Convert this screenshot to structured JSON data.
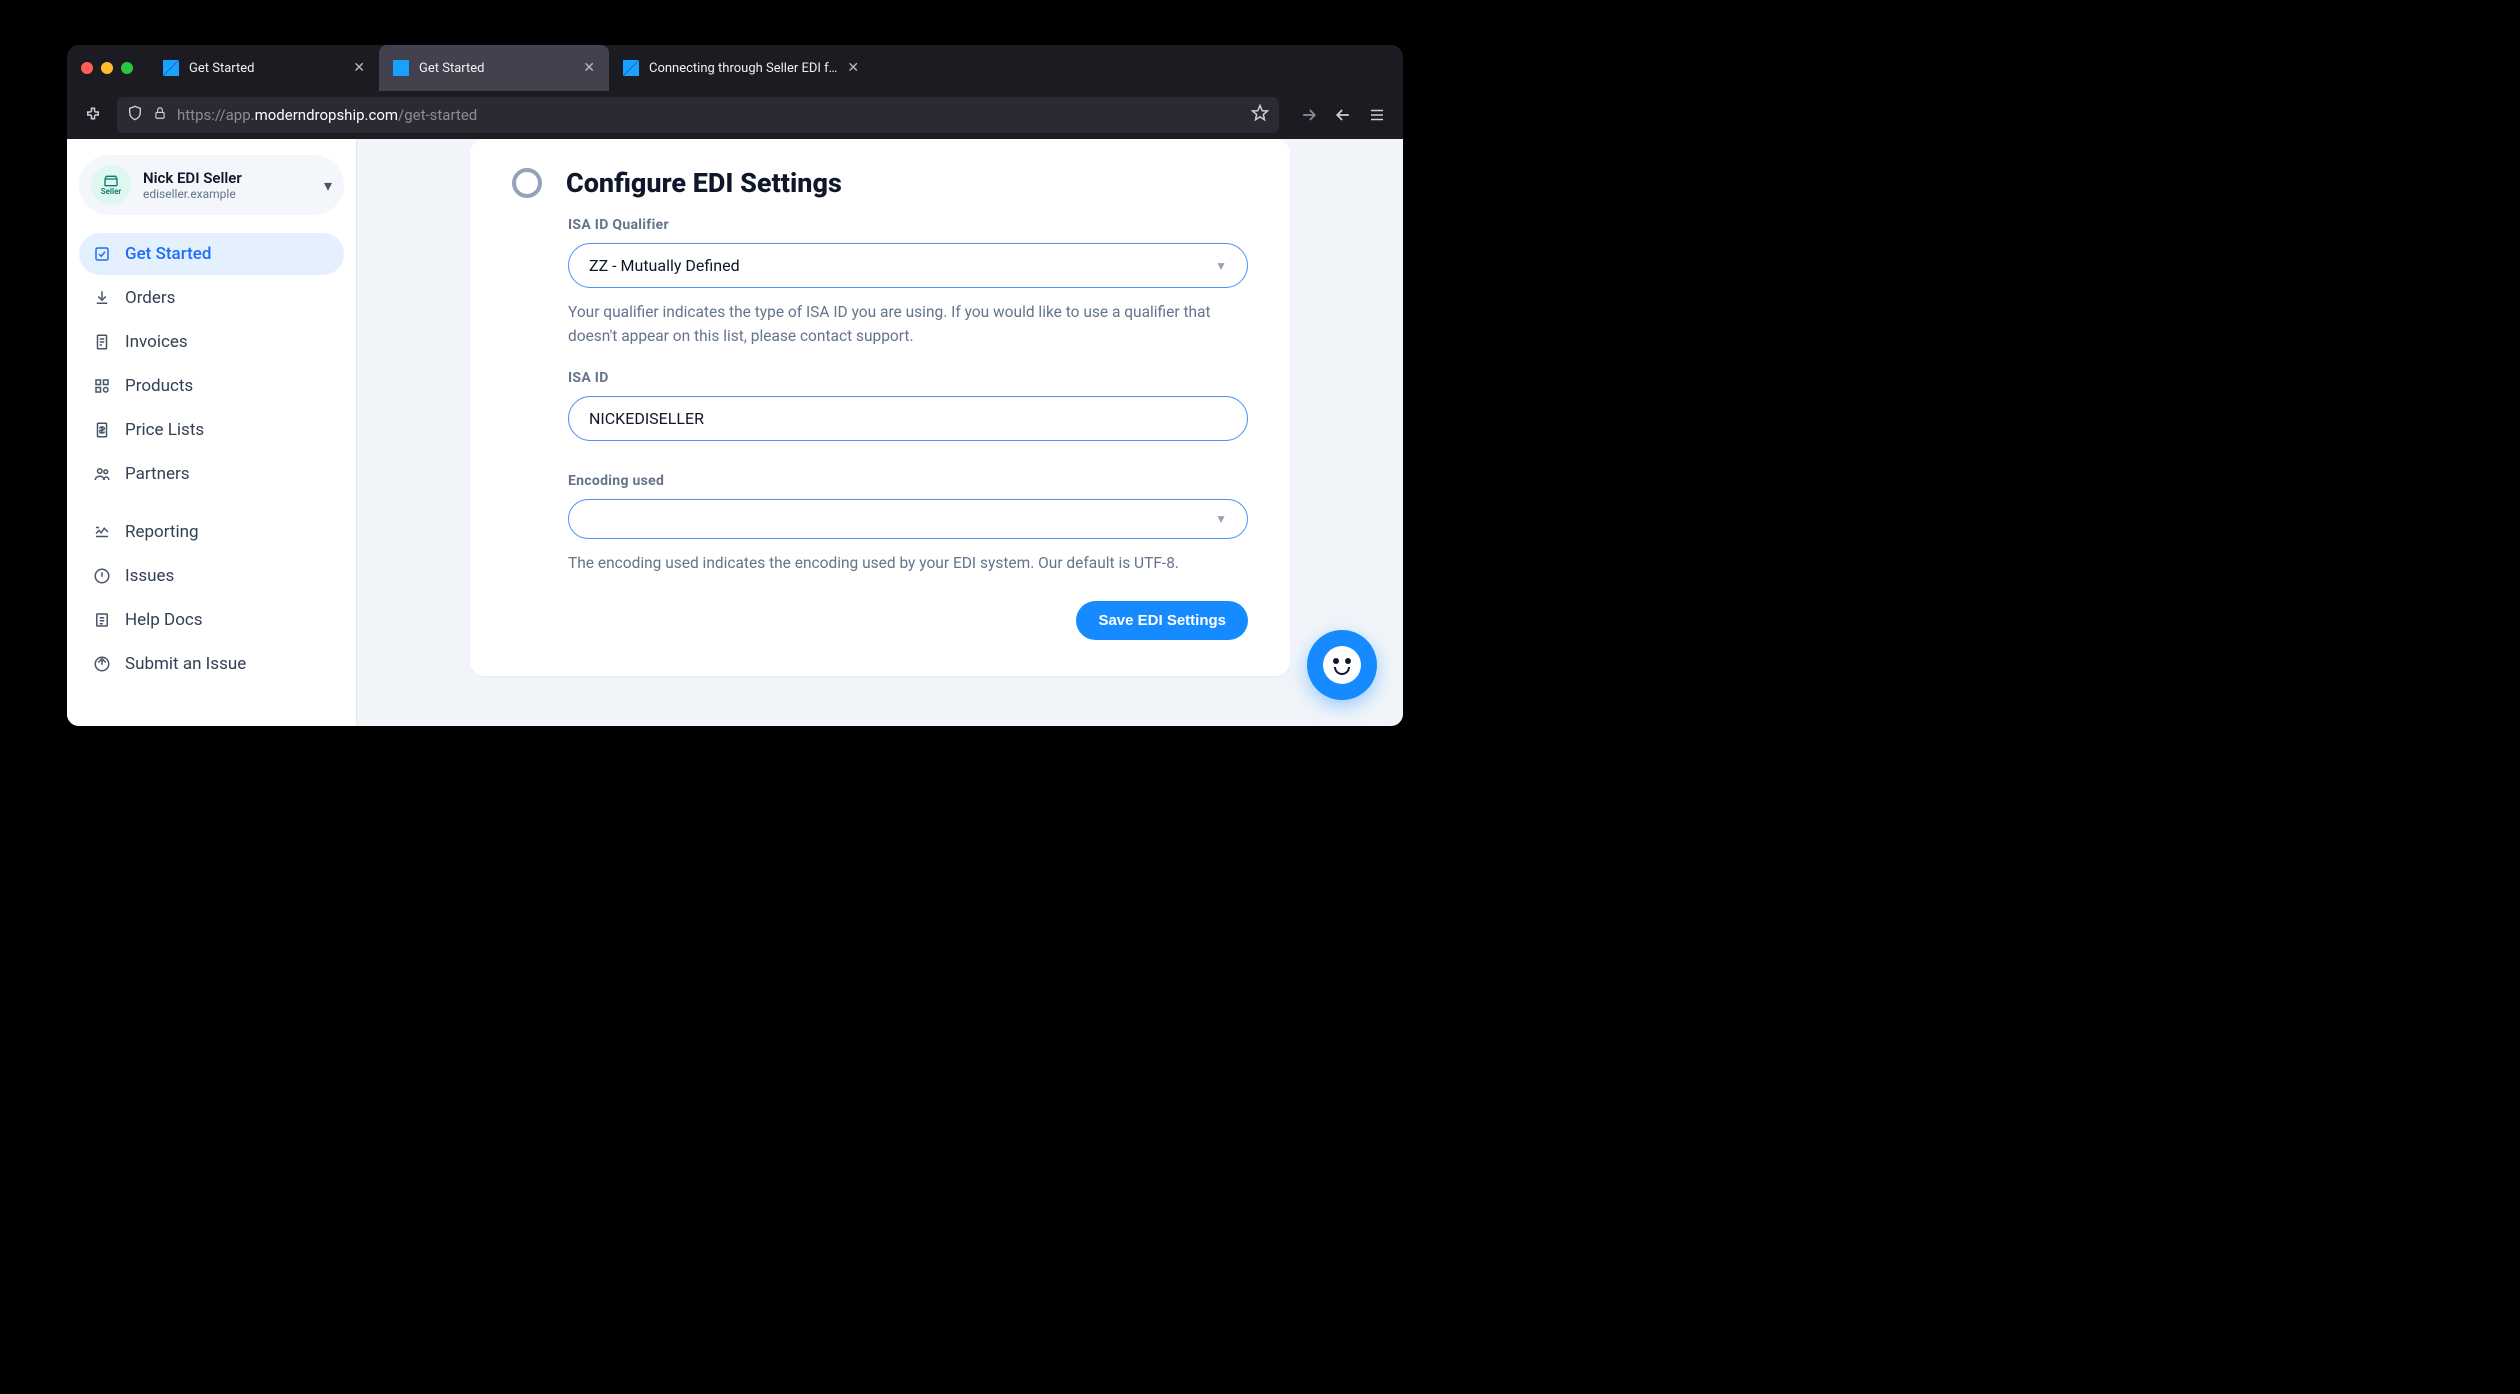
{
  "browser": {
    "tabs": [
      {
        "title": "Get Started"
      },
      {
        "title": "Get Started"
      },
      {
        "title": "Connecting through Seller EDI f…"
      }
    ],
    "url_dim_prefix": "https://app.",
    "url_host": "moderndropship.com",
    "url_path": "/get-started"
  },
  "account": {
    "name": "Nick EDI Seller",
    "subdomain": "ediseller.example",
    "badge": "Seller"
  },
  "nav": {
    "items": [
      "Get Started",
      "Orders",
      "Invoices",
      "Products",
      "Price Lists",
      "Partners",
      "Reporting",
      "Issues",
      "Help Docs",
      "Submit an Issue"
    ]
  },
  "page": {
    "title": "Configure EDI Settings",
    "qualifier_label": "ISA ID Qualifier",
    "qualifier_value": "ZZ - Mutually Defined",
    "qualifier_help": "Your qualifier indicates the type of ISA ID you are using. If you would like to use a qualifier that doesn't appear on this list, please contact support.",
    "isa_label": "ISA ID",
    "isa_value": "NICKEDISELLER",
    "encoding_label": "Encoding used",
    "encoding_value": "",
    "encoding_help": "The encoding used indicates the encoding used by your EDI system. Our default is UTF-8.",
    "save_label": "Save EDI Settings"
  }
}
